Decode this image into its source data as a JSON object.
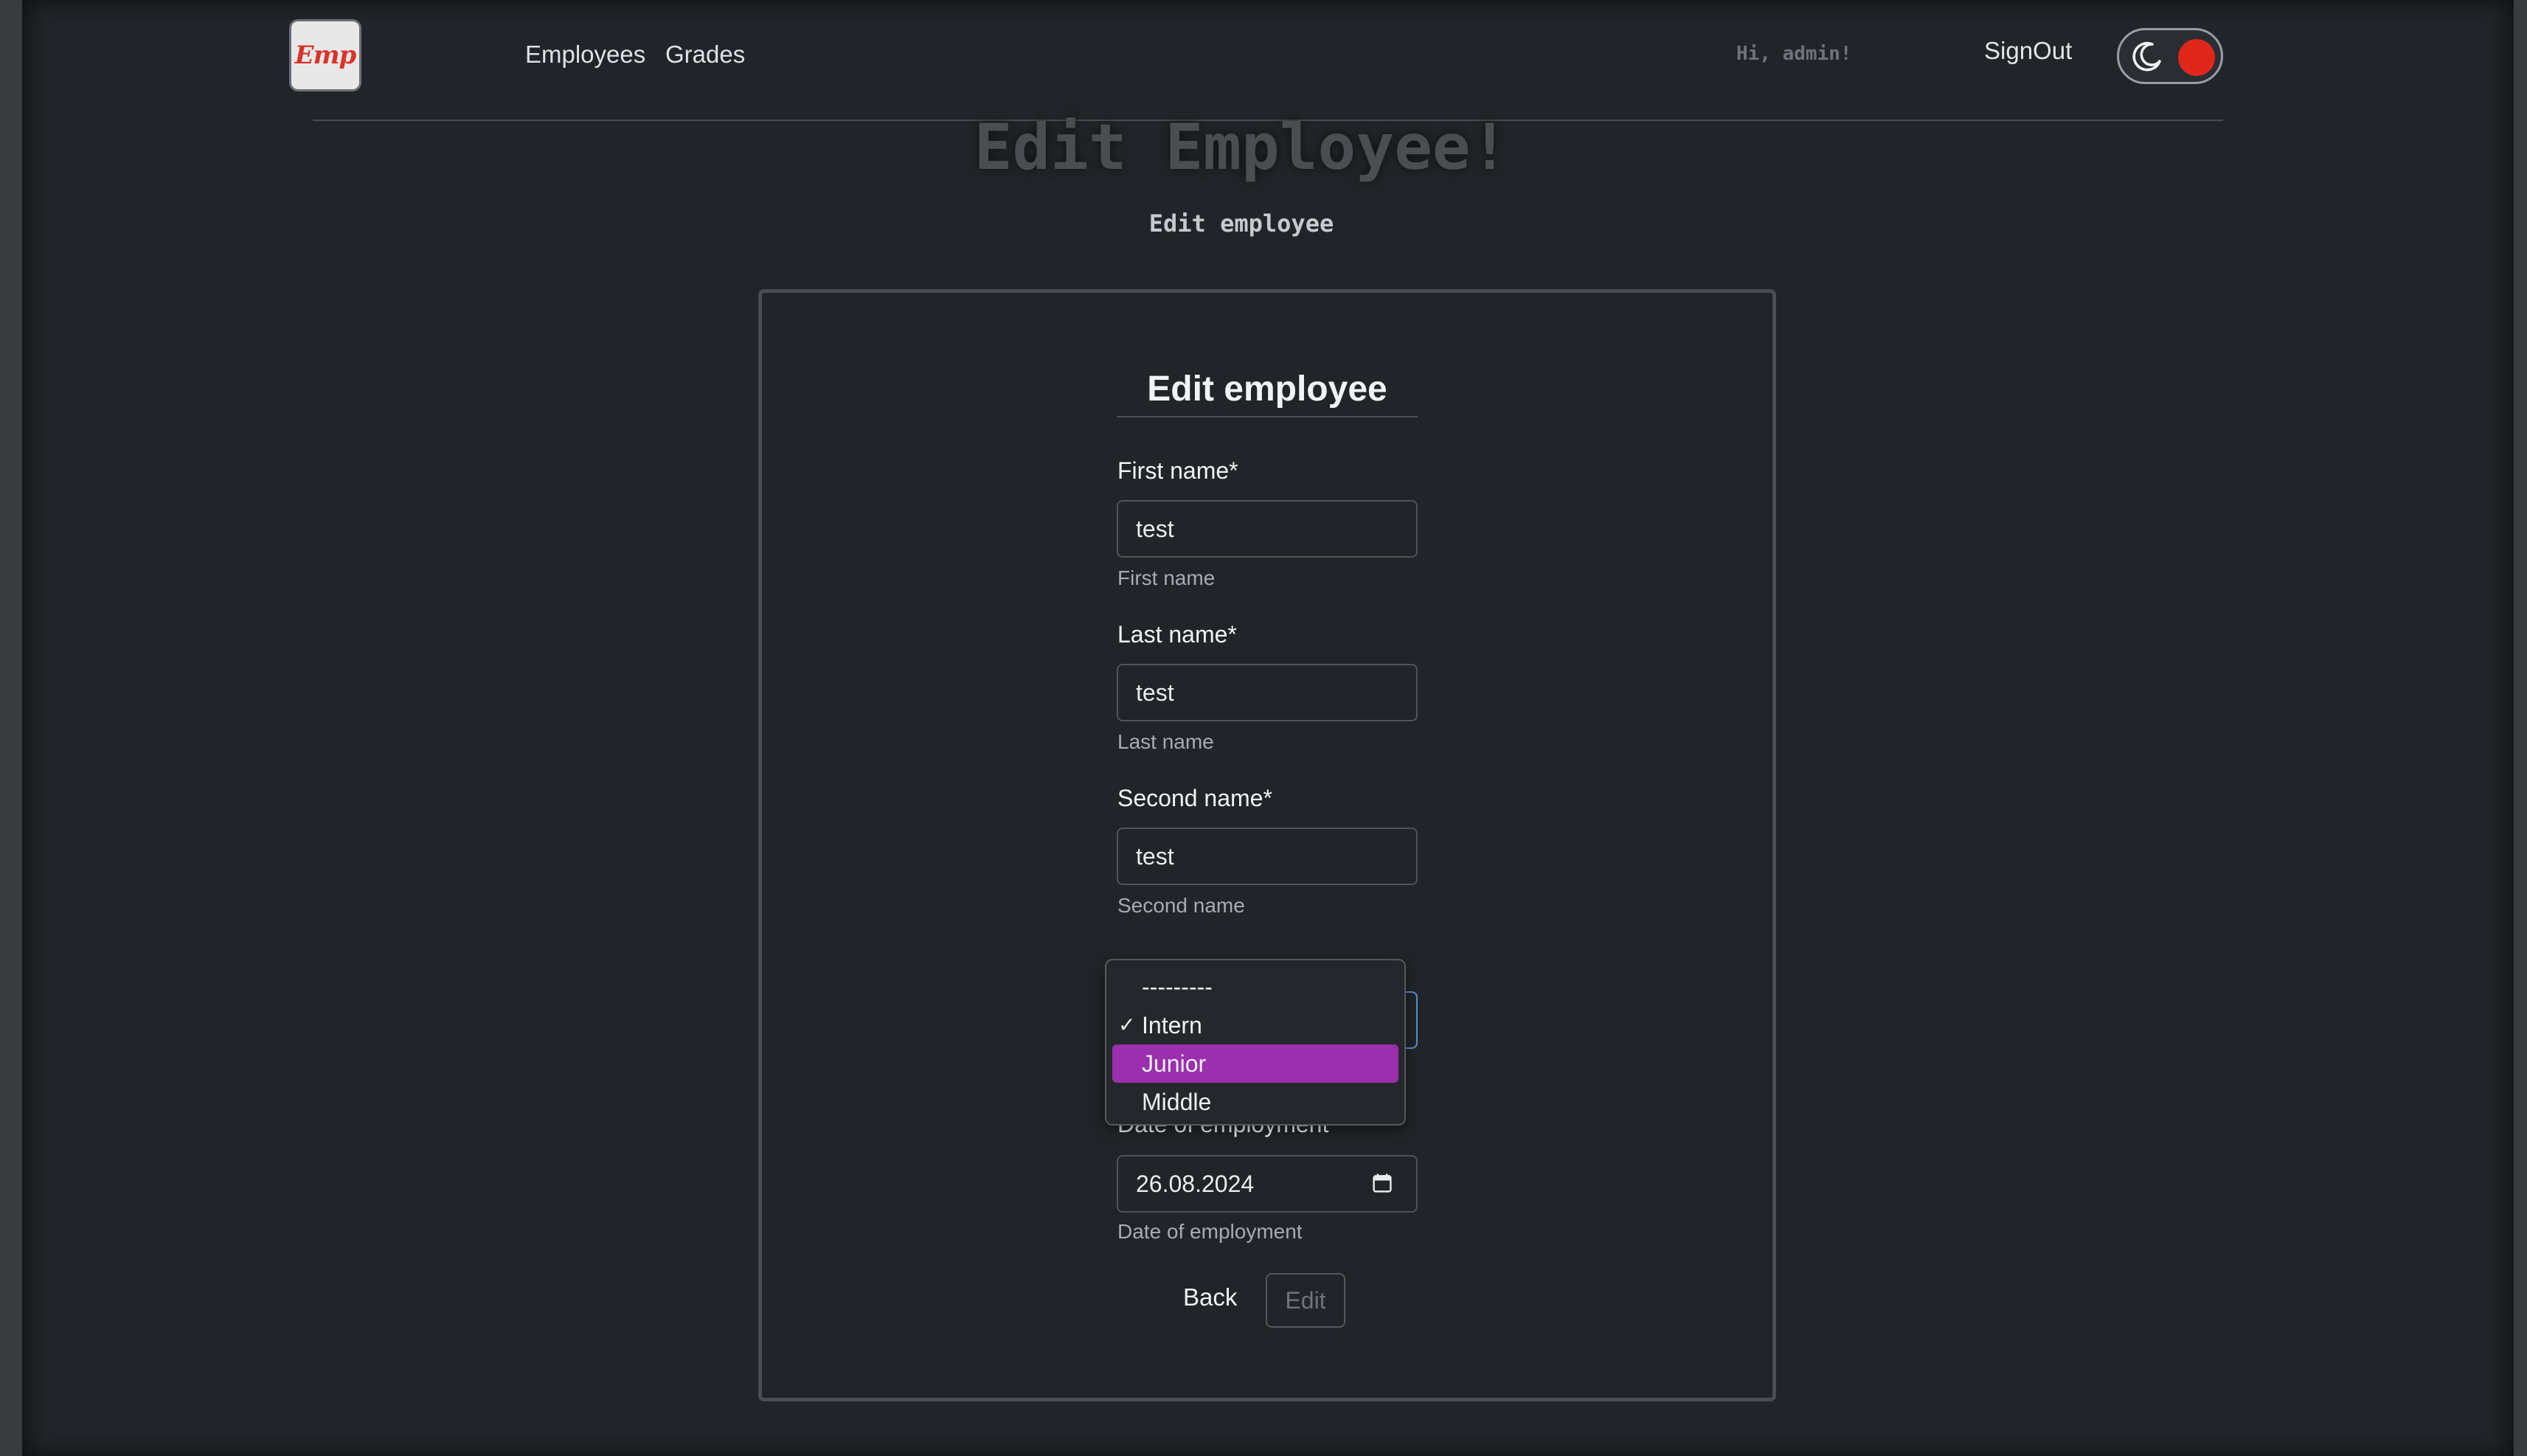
{
  "header": {
    "logo_text": "Emp",
    "nav": [
      {
        "label": "Employees"
      },
      {
        "label": "Grades"
      }
    ],
    "greeting": "Hi, admin!",
    "signout_label": "SignOut",
    "theme_toggle": {
      "icon": "moon-icon",
      "knob_color": "#e0271c"
    }
  },
  "page": {
    "title": "Edit Employee!",
    "subtitle": "Edit employee"
  },
  "form": {
    "title": "Edit employee",
    "fields": {
      "first_name": {
        "label": "First name*",
        "value": "test",
        "help": "First name"
      },
      "last_name": {
        "label": "Last name*",
        "value": "test",
        "help": "Last name"
      },
      "second_name": {
        "label": "Second name*",
        "value": "test",
        "help": "Second name"
      },
      "date": {
        "label": "Date of employment",
        "value": "26.08.2024",
        "help": "Date of employment"
      }
    },
    "grade_dropdown": {
      "options": [
        {
          "label": "---------",
          "checked": false
        },
        {
          "label": "Intern",
          "checked": true
        },
        {
          "label": "Junior",
          "checked": false
        },
        {
          "label": "Middle",
          "checked": false
        }
      ],
      "check_mark": "✓",
      "highlight_color": "#9b2fae"
    },
    "back_label": "Back",
    "edit_label": "Edit"
  }
}
